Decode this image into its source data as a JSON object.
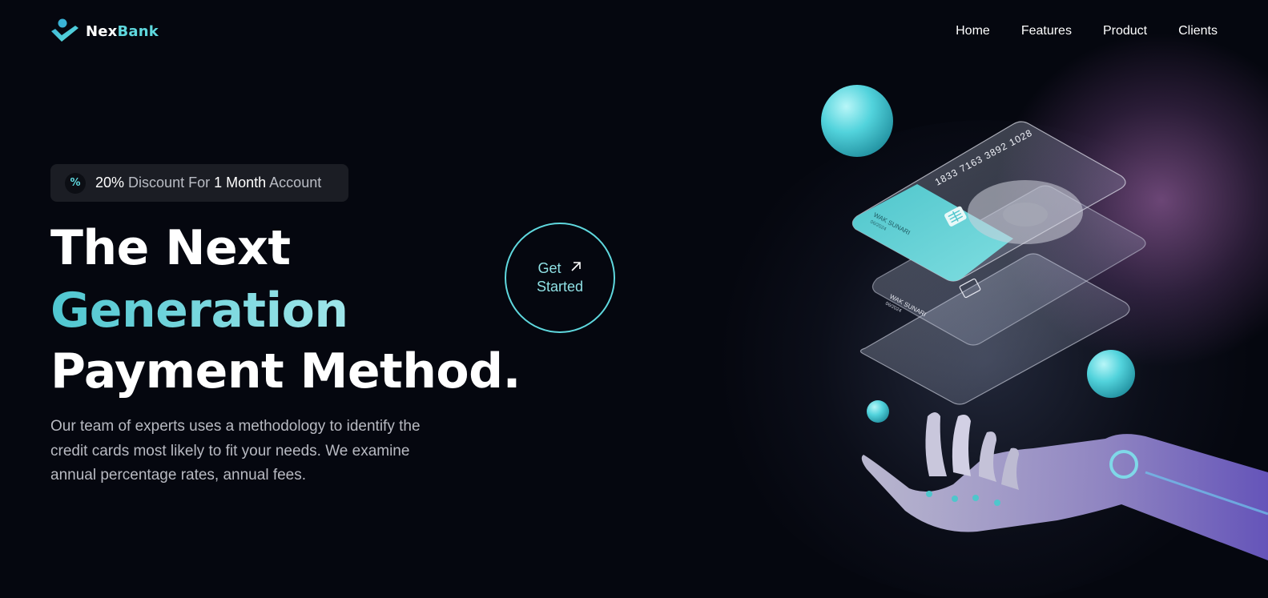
{
  "brand": {
    "name_part1": "Nex",
    "name_part2": "Bank",
    "accent": "#5fd8de"
  },
  "nav": {
    "items": [
      {
        "label": "Home"
      },
      {
        "label": "Features"
      },
      {
        "label": "Product"
      },
      {
        "label": "Clients"
      }
    ]
  },
  "badge": {
    "icon": "percent-icon",
    "value": "20%",
    "text1": "Discount For",
    "highlight": "1 Month",
    "text2": "Account"
  },
  "hero": {
    "line1": "The Next",
    "line2": "Generation",
    "line3": "Payment Method.",
    "description": "Our team of experts uses a methodology to identify the credit cards most likely to fit your needs. We examine annual percentage rates, annual fees."
  },
  "cta": {
    "line1": "Get",
    "line2": "Started",
    "icon": "arrow-up-right-icon"
  },
  "cards": {
    "number": "1833 7163 3892 1028",
    "holder": "WAK SUNARI",
    "expiry": "06/2024"
  }
}
